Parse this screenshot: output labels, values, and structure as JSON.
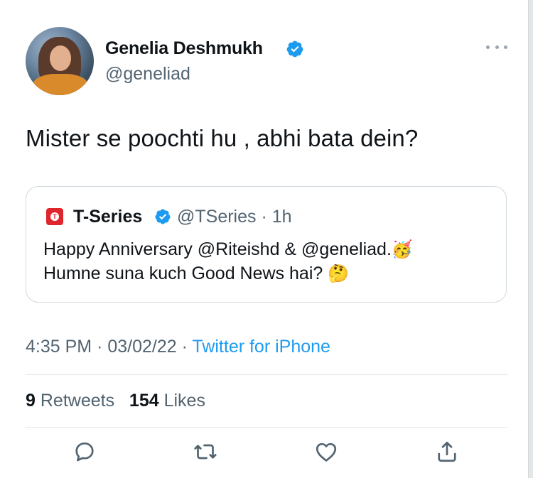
{
  "author": {
    "name": "Genelia Deshmukh",
    "handle": "@geneliad",
    "verified_icon": "verified-badge-icon",
    "more_icon": "more-options-icon"
  },
  "tweet": {
    "text": "Mister se poochti hu , abhi bata dein?",
    "time": "4:35 PM",
    "date": "03/02/22",
    "source": "Twitter for iPhone"
  },
  "quoted_tweet": {
    "name": "T-Series",
    "handle": "@TSeries",
    "age": "1h",
    "line1": "Happy Anniversary @Riteishd & @geneliad.",
    "line1_emoji": "🥳",
    "line2": "Humne suna kuch Good News hai?",
    "line2_emoji": "🤔"
  },
  "stats": {
    "retweets_count": "9",
    "retweets_label": "Retweets",
    "likes_count": "154",
    "likes_label": "Likes"
  },
  "actions": [
    "reply-icon",
    "retweet-icon",
    "like-icon",
    "share-icon"
  ],
  "colors": {
    "primary_text": "#0f1419",
    "secondary_text": "#536471",
    "link": "#1d9bf0",
    "border": "#cfd9de"
  }
}
